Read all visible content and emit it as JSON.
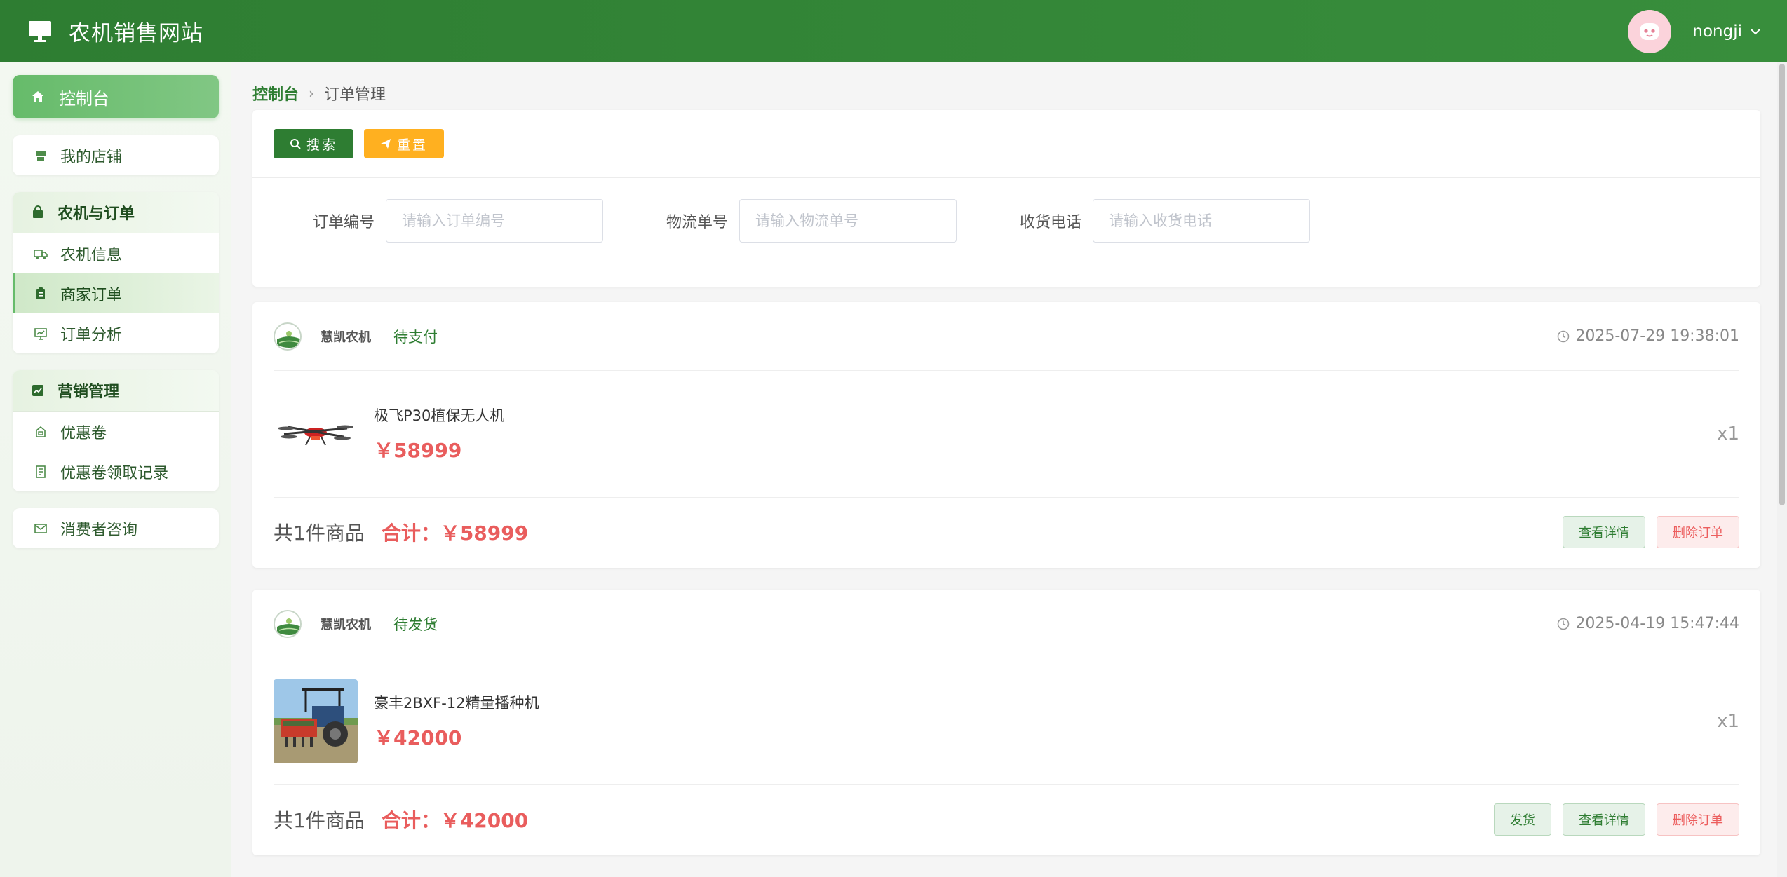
{
  "app": {
    "title": "农机销售网站",
    "username": "nongji"
  },
  "sidebar": {
    "home": "控制台",
    "store": "我的店铺",
    "group1": {
      "title": "农机与订单",
      "items": [
        "农机信息",
        "商家订单",
        "订单分析"
      ]
    },
    "group2": {
      "title": "营销管理",
      "items": [
        "优惠卷",
        "优惠卷领取记录"
      ]
    },
    "consult": "消费者咨询"
  },
  "breadcrumb": {
    "home": "控制台",
    "current": "订单管理"
  },
  "search": {
    "search_btn": "搜索",
    "reset_btn": "重置",
    "filters": [
      {
        "label": "订单编号",
        "placeholder": "请输入订单编号"
      },
      {
        "label": "物流单号",
        "placeholder": "请输入物流单号"
      },
      {
        "label": "收货电话",
        "placeholder": "请输入收货电话"
      }
    ]
  },
  "orders": [
    {
      "shop": "慧凯农机",
      "status": "待支付",
      "time": "2025-07-29 19:38:01",
      "product": "极飞P30植保无人机",
      "price": "￥58999",
      "qty": "x1",
      "count_text": "共1件商品",
      "total_text": "合计：￥58999",
      "actions": [
        "查看详情",
        "删除订单"
      ]
    },
    {
      "shop": "慧凯农机",
      "status": "待发货",
      "time": "2025-04-19 15:47:44",
      "product": "豪丰2BXF-12精量播种机",
      "price": "￥42000",
      "qty": "x1",
      "count_text": "共1件商品",
      "total_text": "合计：￥42000",
      "actions": [
        "发货",
        "查看详情",
        "删除订单"
      ]
    }
  ],
  "colors": {
    "primary": "#2e7d32",
    "accent": "#ffb020",
    "danger": "#e95d5d"
  }
}
